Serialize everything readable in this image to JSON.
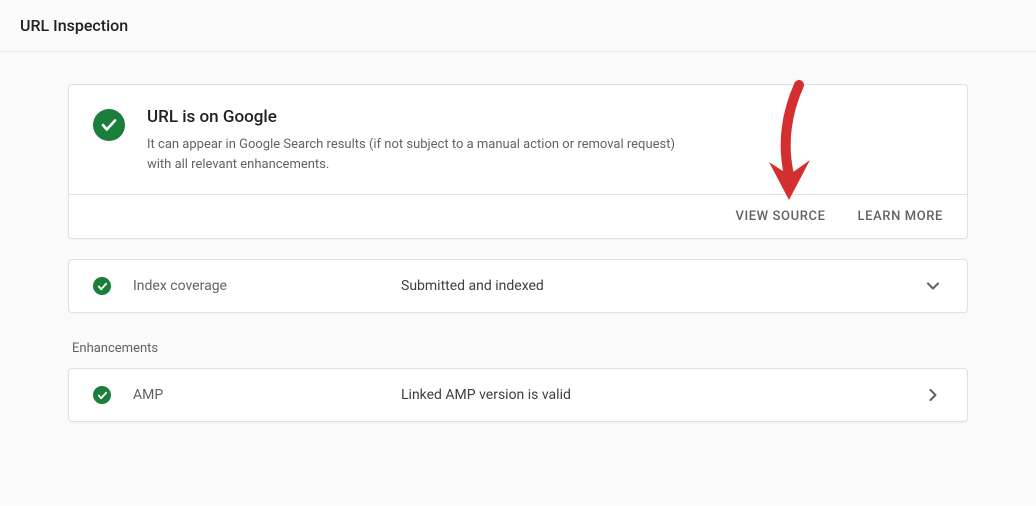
{
  "header": {
    "title": "URL Inspection"
  },
  "status": {
    "title": "URL is on Google",
    "description": "It can appear in Google Search results (if not subject to a manual action or removal request) with all relevant enhancements."
  },
  "footer": {
    "view_source": "VIEW SOURCE",
    "learn_more": "LEARN MORE"
  },
  "coverage": {
    "label": "Index coverage",
    "value": "Submitted and indexed"
  },
  "enhancements": {
    "section_label": "Enhancements"
  },
  "amp": {
    "label": "AMP",
    "value": "Linked AMP version is valid"
  },
  "colors": {
    "success": "#1b7e3a",
    "annotation": "#d32f2f"
  }
}
